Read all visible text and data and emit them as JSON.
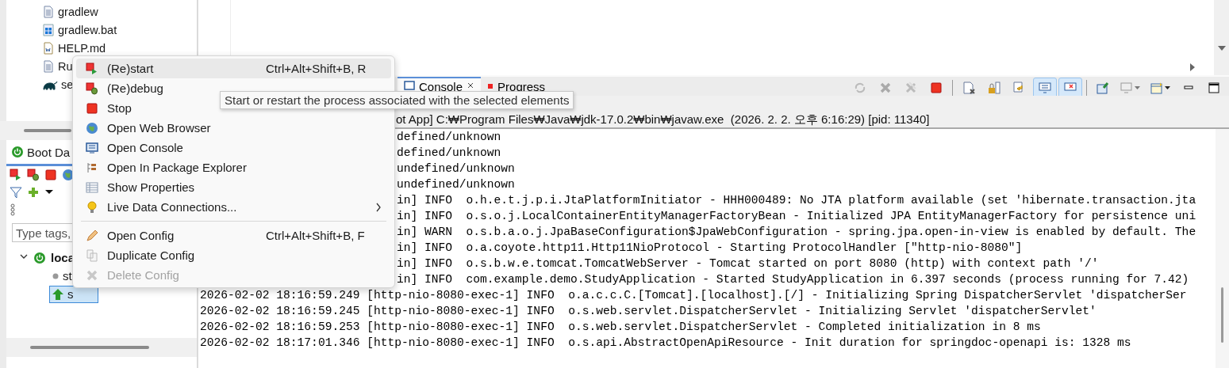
{
  "project_tree": [
    {
      "name": "gradlew"
    },
    {
      "name": "gradlew.bat"
    },
    {
      "name": "HELP.md"
    },
    {
      "name": "Ru"
    },
    {
      "name": "se"
    }
  ],
  "boot_dashboard": {
    "tab": "Boot Da",
    "search": {
      "placeholder": "Type tags,"
    },
    "tree": [
      {
        "name": "loca",
        "expanded": true,
        "children": [
          {
            "name": "st",
            "selected": false
          },
          {
            "name": "s",
            "selected": true
          }
        ]
      }
    ]
  },
  "console_view": {
    "tabs": [
      {
        "label": "Console",
        "selected": true
      },
      {
        "label": "Progress",
        "selected": false
      }
    ],
    "toolbar": [
      {
        "on": false
      },
      {
        "on": false
      },
      {
        "on": false
      },
      {
        "on": false
      },
      {
        "on": false
      },
      {
        "on": false
      },
      {
        "on": false
      },
      {
        "on": true
      },
      {
        "on": true
      },
      {
        "on": false
      },
      {
        "on": false
      },
      {
        "on": false
      },
      {
        "on": false
      },
      {
        "on": false
      }
    ],
    "process": "ot App] C:₩Program Files₩Java₩jdk-17.0.2₩bin₩javaw.exe  (2026. 2. 2. 오후 6:16:29) [pid: 11340]",
    "lines": [
      {
        "kind": "covered",
        "text": "defined/unknown"
      },
      {
        "kind": "covered",
        "text": "defined/unknown"
      },
      {
        "kind": "covered",
        "text": "undefined/unknown"
      },
      {
        "kind": "covered",
        "text": "undefined/unknown"
      },
      {
        "kind": "covered",
        "text": "in] INFO  o.h.e.t.j.p.i.JtaPlatformInitiator - HHH000489: No JTA platform available (set 'hibernate.transaction.jta"
      },
      {
        "kind": "covered",
        "text": "in] INFO  o.s.o.j.LocalContainerEntityManagerFactoryBean - Initialized JPA EntityManagerFactory for persistence uni"
      },
      {
        "kind": "covered",
        "text": "in] WARN  o.s.b.a.o.j.JpaBaseConfiguration$JpaWebConfiguration - spring.jpa.open-in-view is enabled by default. The"
      },
      {
        "kind": "covered",
        "text": "in] INFO  o.a.coyote.http11.Http11NioProtocol - Starting ProtocolHandler [\"http-nio-8080\"]"
      },
      {
        "kind": "covered",
        "text": "in] INFO  o.s.b.w.e.tomcat.TomcatWebServer - Tomcat started on port 8080 (http) with context path '/'"
      },
      {
        "kind": "covered",
        "text": "in] INFO  com.example.demo.StudyApplication - Started StudyApplication in 6.397 seconds (process running for 7.42)"
      },
      {
        "kind": "full",
        "text": "2026-02-02 18:16:59.249 [http-nio-8080-exec-1] INFO  o.a.c.c.C.[Tomcat].[localhost].[/] - Initializing Spring DispatcherServlet 'dispatcherSer"
      },
      {
        "kind": "full",
        "text": "2026-02-02 18:16:59.245 [http-nio-8080-exec-1] INFO  o.s.web.servlet.DispatcherServlet - Initializing Servlet 'dispatcherServlet'"
      },
      {
        "kind": "full",
        "text": "2026-02-02 18:16:59.253 [http-nio-8080-exec-1] INFO  o.s.web.servlet.DispatcherServlet - Completed initialization in 8 ms"
      },
      {
        "kind": "full",
        "text": "2026-02-02 18:17:01.346 [http-nio-8080-exec-1] INFO  o.s.api.AbstractOpenApiResource - Init duration for springdoc-openapi is: 1328 ms"
      }
    ]
  },
  "context_menu": {
    "items": [
      {
        "kind": "item",
        "label": "(Re)start",
        "shortcut": "Ctrl+Alt+Shift+B, R",
        "selected": true,
        "disabled": false
      },
      {
        "kind": "item",
        "label": "(Re)debug",
        "selected": false,
        "disabled": false
      },
      {
        "kind": "item",
        "label": "Stop",
        "selected": false,
        "disabled": false
      },
      {
        "kind": "item",
        "label": "Open Web Browser",
        "selected": false,
        "disabled": false
      },
      {
        "kind": "item",
        "label": "Open Console",
        "selected": false,
        "disabled": false
      },
      {
        "kind": "item",
        "label": "Open In Package Explorer",
        "selected": false,
        "disabled": false
      },
      {
        "kind": "item",
        "label": "Show Properties",
        "selected": false,
        "disabled": false
      },
      {
        "kind": "submenu",
        "label": "Live Data Connections...",
        "selected": false,
        "disabled": false
      },
      {
        "kind": "separator"
      },
      {
        "kind": "item",
        "label": "Open Config",
        "shortcut": "Ctrl+Alt+Shift+B, F",
        "selected": false,
        "disabled": false
      },
      {
        "kind": "item",
        "label": "Duplicate Config",
        "selected": false,
        "disabled": false
      },
      {
        "kind": "item",
        "label": "Delete Config",
        "selected": false,
        "disabled": true
      }
    ]
  },
  "tooltip": "Start or restart the process associated with the selected elements"
}
